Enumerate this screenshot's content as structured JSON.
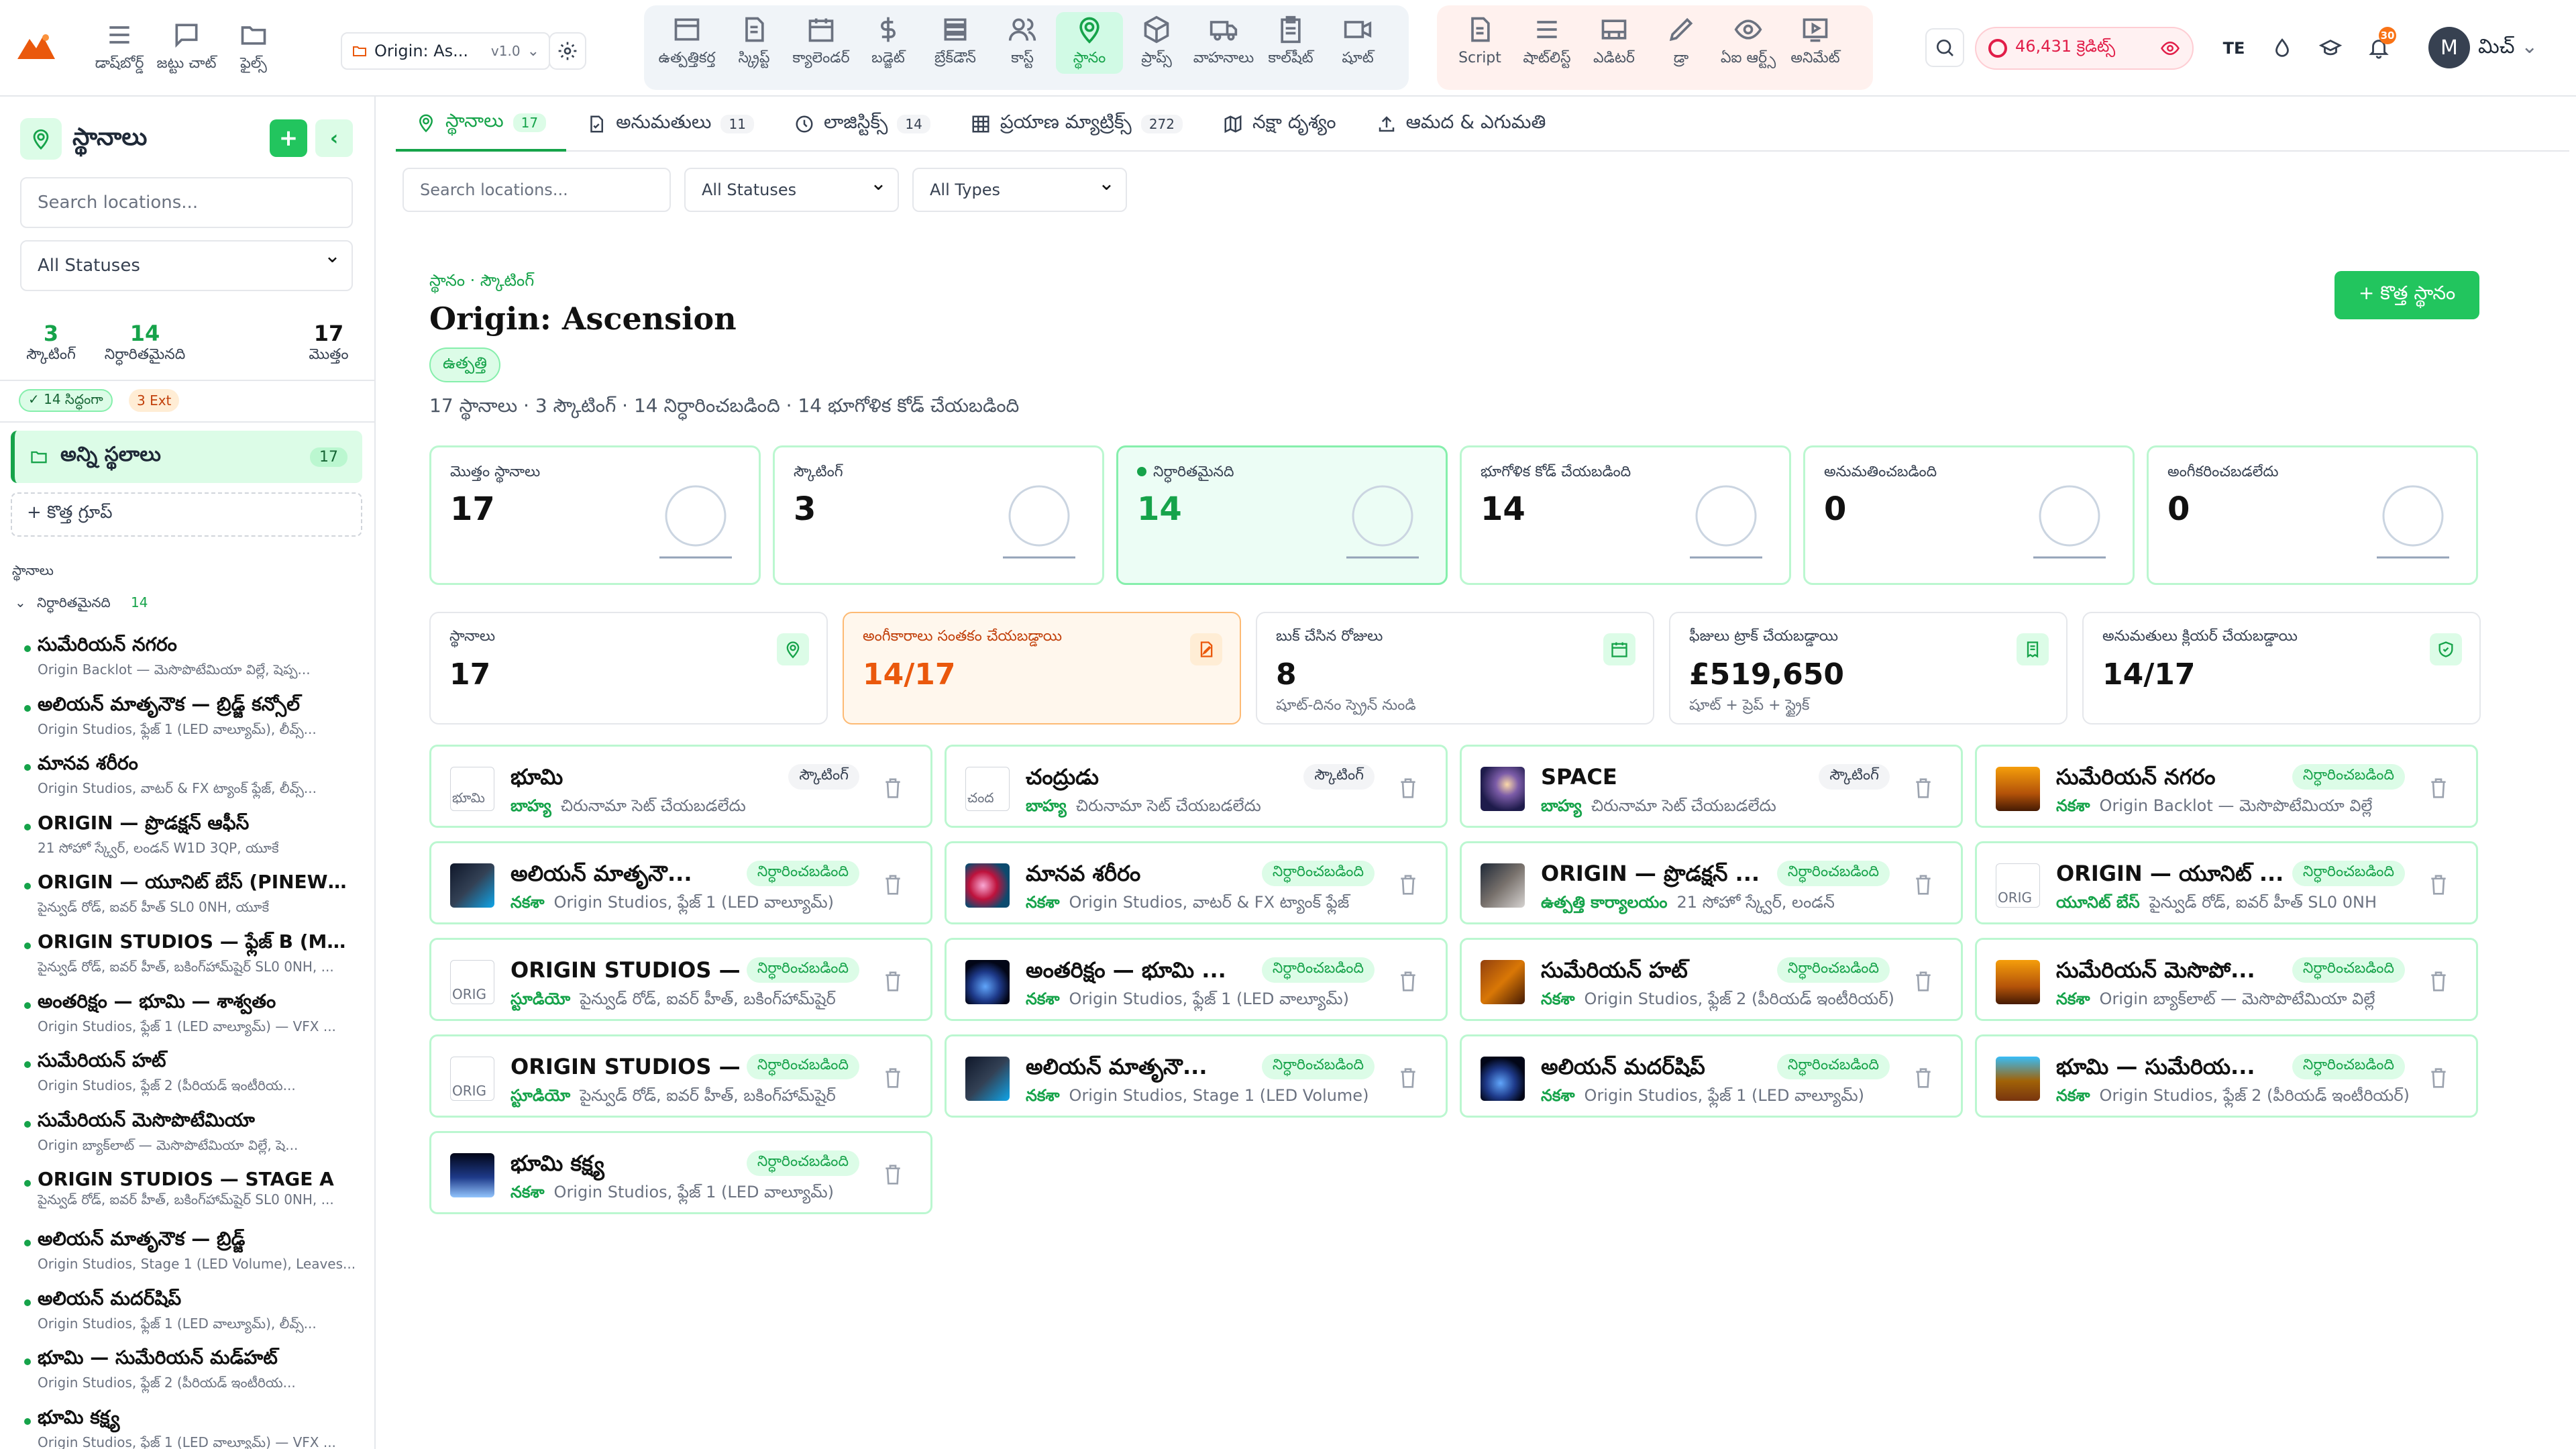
{
  "nav": {
    "left": [
      {
        "label": "డాష్‌బోర్డ్",
        "icon": "menu-icon"
      },
      {
        "label": "జట్టు చాట్",
        "icon": "chat-icon"
      },
      {
        "label": "ఫైల్స్",
        "icon": "folder-icon"
      }
    ],
    "project": {
      "name": "Origin: As...",
      "version": "v1.0"
    },
    "main": [
      {
        "label": "ఉత్పత్తికర్త",
        "icon": "film-icon"
      },
      {
        "label": "స్క్రిప్ట్",
        "icon": "document-icon"
      },
      {
        "label": "క్యాలెండర్",
        "icon": "calendar-icon"
      },
      {
        "label": "బడ్జెట్",
        "icon": "dollar-icon"
      },
      {
        "label": "బ్రేక్‌డౌన్",
        "icon": "list-icon"
      },
      {
        "label": "కాస్ట్",
        "icon": "users-icon"
      },
      {
        "label": "స్థానం",
        "icon": "location-pin-icon"
      },
      {
        "label": "ప్రాప్స్",
        "icon": "cube-icon"
      },
      {
        "label": "వాహనాలు",
        "icon": "truck-icon"
      },
      {
        "label": "కాల్‌షీట్",
        "icon": "clipboard-icon"
      },
      {
        "label": "షూట్",
        "icon": "camera-icon"
      }
    ],
    "tools": [
      {
        "label": "Script",
        "icon": "script-icon"
      },
      {
        "label": "షాట్‌లిస్ట్",
        "icon": "list-icon"
      },
      {
        "label": "ఎడిటర్",
        "icon": "editor-icon"
      },
      {
        "label": "డ్రా",
        "icon": "pen-icon"
      },
      {
        "label": "ఏఐ ఆర్ట్స్",
        "icon": "eye-icon"
      },
      {
        "label": "అనిమేట్",
        "icon": "play-icon"
      }
    ],
    "credits": "46,431 క్రెడిట్స్",
    "lang": "TE",
    "notif_count": "30",
    "user_initial": "M",
    "user_name": "మిచ్"
  },
  "sidebar": {
    "title": "స్థానాలు",
    "add": "+",
    "collapse": "‹",
    "search_placeholder": "Search locations...",
    "status_filter": "All Statuses",
    "stats": [
      {
        "value": "3",
        "label": "స్కౌటింగ్"
      },
      {
        "value": "14",
        "label": "నిర్ధారితమైనది"
      },
      {
        "value": "17",
        "label": "మొత్తం"
      }
    ],
    "ready_tag": "✓ 14 సిద్ధంగా",
    "ext_tag": "3 Ext",
    "all_locations": "అన్ని స్థలాలు",
    "all_count": "17",
    "new_group": "+  కొత్త గ్రూప్",
    "section": "స్థానాలు",
    "group_label": "నిర్ధారితమైనది",
    "group_count": "14",
    "items": [
      {
        "title": "సుమేరియన్ నగరం",
        "sub": "Origin Backlot — మెసొపొటేమియా విల్లే, షెప్ప..."
      },
      {
        "title": "అలియన్ మాతృనౌక — బ్రిడ్జ్ కన్సోల్",
        "sub": "Origin Studios, ఫ్లేజ్ 1 (LED వాల్యూమ్), లీవ్స్..."
      },
      {
        "title": "మానవ శరీరం",
        "sub": "Origin Studios, వాటర్ & FX ట్యాంక్ ఫ్లేజ్, లీవ్స్..."
      },
      {
        "title": "ORIGIN — ప్రొడక్షన్ ఆఫీస్",
        "sub": "21 సోహో స్క్వేర్, లండన్ W1D 3QP, యూకే"
      },
      {
        "title": "ORIGIN — యూనిట్ బేస్ (PINEWOOD)",
        "sub": "పైన్వుడ్ రోడ్, ఐవర్ హీత్ SL0 0NH, యూకే"
      },
      {
        "title": "ORIGIN STUDIOS — ఫ్లేజ్ B (MOTHE...",
        "sub": "పైన్వుడ్ రోడ్, ఐవర్ హీత్, బకింగ్‌హామ్‌షైర్ SL0 0NH, ..."
      },
      {
        "title": "అంతరిక్షం — భూమి — శాశ్వతం",
        "sub": "Origin Studios, ఫ్లేజ్ 1 (LED వాల్యూమ్) — VFX ..."
      },
      {
        "title": "సుమేరియన్ హట్",
        "sub": "Origin Studios, ఫ్లేజ్ 2 (పీరియడ్ ఇంటీరియ..."
      },
      {
        "title": "సుమేరియన్ మెసొపొటేమియా",
        "sub": "Origin బ్యాక్‌లాట్ — మెసొపొటేమియా విల్లే, షె..."
      },
      {
        "title": "ORIGIN STUDIOS — STAGE A",
        "sub": "పైన్వుడ్ రోడ్, ఐవర్ హీత్, బకింగ్‌హామ్‌షైర్ SL0 0NH, ..."
      },
      {
        "title": "అలియన్ మాతృనౌక — బ్రిడ్జ్",
        "sub": "Origin Studios, Stage 1 (LED Volume), Leaves..."
      },
      {
        "title": "అలియన్ మదర్‌షిప్",
        "sub": "Origin Studios, ఫ్లేజ్ 1 (LED వాల్యూమ్), లీవ్స్..."
      },
      {
        "title": "భూమి — సుమేరియన్ మడ్‌హట్",
        "sub": "Origin Studios, ఫ్లేజ్ 2 (పీరియడ్ ఇంటీరియ..."
      },
      {
        "title": "భూమి కక్ష్య",
        "sub": "Origin Studios, ఫ్లేజ్ 1 (LED వాల్యూమ్) — VFX ..."
      }
    ]
  },
  "tabs": [
    {
      "label": "స్థానాలు",
      "count": "17",
      "icon": "location-pin-icon",
      "active": true
    },
    {
      "label": "అనుమతులు",
      "count": "11",
      "icon": "document-icon",
      "active": false
    },
    {
      "label": "లాజిస్టిక్స్",
      "count": "14",
      "icon": "clock-icon",
      "active": false
    },
    {
      "label": "ప్రయాణ మ్యాట్రిక్స్",
      "count": "272",
      "icon": "grid-icon",
      "active": false
    },
    {
      "label": "నక్షా దృశ్యం",
      "count": "",
      "icon": "map-icon",
      "active": false
    },
    {
      "label": "ఆమద & ఎగుమతి",
      "count": "",
      "icon": "upload-icon",
      "active": false
    }
  ],
  "filters": {
    "search_placeholder": "Search locations...",
    "status": "All Statuses",
    "type": "All Types"
  },
  "header": {
    "breadcrumb": "స్థానం · స్కౌటింగ్",
    "title": "Origin: Ascension",
    "phase": "ఉత్పత్తి",
    "summary": "17 స్థానాలు · 3 స్కౌటింగ్ · 14 నిర్ధారించబడింది · 14 భూగోళిక కోడ్ చేయబడింది",
    "new_button": "+ కొత్త స్థానం"
  },
  "stat_cards": [
    {
      "label": "మొత్తం స్థానాలు",
      "value": "17",
      "highlight": false,
      "dot": false
    },
    {
      "label": "స్కౌటింగ్",
      "value": "3",
      "highlight": false,
      "dot": false
    },
    {
      "label": "నిర్ధారితమైనది",
      "value": "14",
      "highlight": true,
      "dot": true
    },
    {
      "label": "భూగోళిక కోడ్ చేయబడింది",
      "value": "14",
      "highlight": false,
      "dot": false
    },
    {
      "label": "అనుమతించబడింది",
      "value": "0",
      "highlight": false,
      "dot": false
    },
    {
      "label": "అంగీకరించబడలేదు",
      "value": "0",
      "highlight": false,
      "dot": false
    }
  ],
  "metric_cards": [
    {
      "label": "స్థానాలు",
      "value": "17",
      "sub": "",
      "warn": false,
      "icon": "location-pin-icon"
    },
    {
      "label": "అంగీకారాలు సంతకం చేయబడ్డాయి",
      "value": "14/17",
      "sub": "",
      "warn": true,
      "icon": "edit-icon"
    },
    {
      "label": "బుక్ చేసిన రోజులు",
      "value": "8",
      "sub": "షూట్-దినం స్ప్రెన్ నుండి",
      "warn": false,
      "icon": "calendar-icon"
    },
    {
      "label": "ఫీజులు ట్రాక్ చేయబడ్డాయి",
      "value": "£519,650",
      "sub": "షూట్ + ప్రెప్ + స్ట్రైక్",
      "warn": false,
      "icon": "receipt-icon"
    },
    {
      "label": "అనుమతులు క్లియర్ చేయబడ్డాయి",
      "value": "14/17",
      "sub": "",
      "warn": false,
      "icon": "shield-icon"
    }
  ],
  "locations": [
    {
      "name": "భూమి",
      "status": "స్కౌటింగ్",
      "type": "బాహ్య",
      "address": "చిరునామా సెట్ చేయబడలేదు",
      "thumb": "broken",
      "alt": "భూమి"
    },
    {
      "name": "చంద్రుడు",
      "status": "స్కౌటింగ్",
      "type": "బాహ్య",
      "address": "చిరునామా సెట్ చేయబడలేదు",
      "thumb": "broken",
      "alt": "చంద"
    },
    {
      "name": "SPACE",
      "status": "స్కౌటింగ్",
      "type": "బాహ్య",
      "address": "చిరునామా సెట్ చేయబడలేదు",
      "thumb": "space",
      "alt": ""
    },
    {
      "name": "సుమేరియన్ నగరం",
      "status": "నిర్ధారించబడింది",
      "type": "నకశా",
      "address": "Origin Backlot — మెసొపొటేమియా విల్లే",
      "thumb": "desert",
      "alt": ""
    },
    {
      "name": "అలియన్ మాతృనౌ...",
      "status": "నిర్ధారించబడింది",
      "type": "నకశా",
      "address": "Origin Studios, ఫ్లేజ్ 1 (LED వాల్యూమ్)",
      "thumb": "ship",
      "alt": ""
    },
    {
      "name": "మానవ శరీరం",
      "status": "నిర్ధారించబడింది",
      "type": "నకశా",
      "address": "Origin Studios, వాటర్ & FX ట్యాంక్ ఫ్లేజ్",
      "thumb": "cell",
      "alt": ""
    },
    {
      "name": "ORIGIN — ప్రొడక్షన్ ...",
      "status": "నిర్ధారించబడింది",
      "type": "ఉత్పత్తి కార్యాలయం",
      "address": "21 సోహో స్క్వేర్, లండన్",
      "thumb": "office",
      "alt": ""
    },
    {
      "name": "ORIGIN — యూనిట్ ...",
      "status": "నిర్ధారించబడింది",
      "type": "యూనిట్ బేస్",
      "address": "పైన్వుడ్ రోడ్, ఐవర్ హీత్ SL0 0NH",
      "thumb": "broken",
      "alt": "ORIG"
    },
    {
      "name": "ORIGIN STUDIOS — ...",
      "status": "నిర్ధారించబడింది",
      "type": "స్టూడియో",
      "address": "పైన్వుడ్ రోడ్, ఐవర్ హీత్, బకింగ్‌హామ్‌షైర్",
      "thumb": "broken",
      "alt": "ORIG"
    },
    {
      "name": "అంతరిక్షం — భూమి ...",
      "status": "నిర్ధారించబడింది",
      "type": "నకశా",
      "address": "Origin Studios, ఫ్లేజ్ 1 (LED వాల్యూమ్)",
      "thumb": "earth",
      "alt": ""
    },
    {
      "name": "సుమేరియన్ హట్",
      "status": "నిర్ధారించబడింది",
      "type": "నకశా",
      "address": "Origin Studios, ఫ్లేజ్ 2 (పీరియడ్ ఇంటీరియర్)",
      "thumb": "hut",
      "alt": ""
    },
    {
      "name": "సుమేరియన్ మెసొపో...",
      "status": "నిర్ధారించబడింది",
      "type": "నకశా",
      "address": "Origin బ్యాక్‌లాట్ — మెసొపొటేమియా విల్లే",
      "thumb": "desert",
      "alt": ""
    },
    {
      "name": "ORIGIN STUDIOS — ...",
      "status": "నిర్ధారించబడింది",
      "type": "స్టూడియో",
      "address": "పైన్వుడ్ రోడ్, ఐవర్ హీత్, బకింగ్‌హామ్‌షైర్",
      "thumb": "broken",
      "alt": "ORIG"
    },
    {
      "name": "అలియన్ మాతృనౌ...",
      "status": "నిర్ధారించబడింది",
      "type": "నకశా",
      "address": "Origin Studios, Stage 1 (LED Volume)",
      "thumb": "ship",
      "alt": ""
    },
    {
      "name": "అలియన్ మదర్‌షిప్",
      "status": "నిర్ధారించబడింది",
      "type": "నకశా",
      "address": "Origin Studios, ఫ్లేజ్ 1 (LED వాల్యూమ్)",
      "thumb": "earth",
      "alt": ""
    },
    {
      "name": "భూమి — సుమేరియ...",
      "status": "నిర్ధారించబడింది",
      "type": "నకశా",
      "address": "Origin Studios, ఫ్లేజ్ 2 (పీరియడ్ ఇంటీరియర్)",
      "thumb": "mud",
      "alt": ""
    },
    {
      "name": "భూమి కక్ష్య",
      "status": "నిర్ధారించబడింది",
      "type": "నకశా",
      "address": "Origin Studios, ఫ్లేజ్ 1 (LED వాల్యూమ్)",
      "thumb": "orbit",
      "alt": ""
    }
  ],
  "colors": {
    "accent": "#16a34a",
    "accent_light": "#dcfce7",
    "warn": "#ea580c",
    "credits": "#e11d48"
  }
}
